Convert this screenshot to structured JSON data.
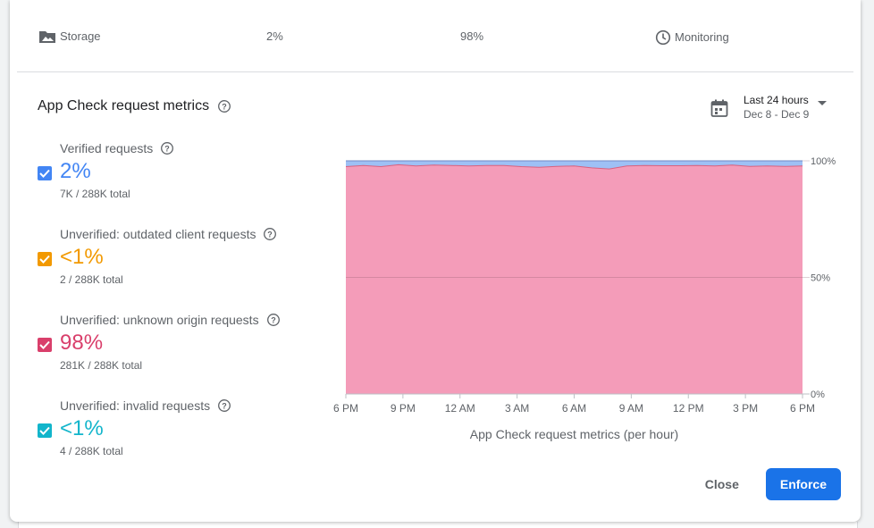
{
  "storage_row": {
    "label": "Storage",
    "verified_pct": "2%",
    "unverified_pct": "98%",
    "mode": "Monitoring"
  },
  "section": {
    "title": "App Check request metrics"
  },
  "date_picker": {
    "range": "Last 24 hours",
    "dates": "Dec 8 - Dec 9"
  },
  "metrics": [
    {
      "label": "Verified requests",
      "value": "2%",
      "sub": "7K / 288K total",
      "color": "#4285f4"
    },
    {
      "label": "Unverified: outdated client requests",
      "value": "<1%",
      "sub": "2 / 288K total",
      "color": "#f29900"
    },
    {
      "label": "Unverified: unknown origin requests",
      "value": "98%",
      "sub": "281K / 288K total",
      "color": "#d93f6b"
    },
    {
      "label": "Unverified: invalid requests",
      "value": "<1%",
      "sub": "4 / 288K total",
      "color": "#12b5cb"
    }
  ],
  "chart_data": {
    "type": "area",
    "stacked": true,
    "percent": true,
    "title": "",
    "xlabel": "App Check request metrics (per hour)",
    "ylabel": "",
    "x_ticks": [
      "6 PM",
      "9 PM",
      "12 AM",
      "3 AM",
      "6 AM",
      "9 AM",
      "12 PM",
      "3 PM",
      "6 PM"
    ],
    "y_ticks": [
      "100%",
      "50%",
      "0%"
    ],
    "ylim": [
      0,
      100
    ],
    "grid": "horizontal",
    "series": [
      {
        "values": [
          97.5,
          98,
          97.5,
          98.3,
          97.8,
          98.2,
          98,
          97.8,
          98,
          98,
          97.5,
          97.2,
          97.6,
          97.8,
          97,
          96.5,
          97.8,
          98,
          97.9,
          97.9,
          98,
          97.8,
          98.2,
          97.6,
          97.8,
          97.6,
          97.8
        ]
      },
      {
        "values": [
          2.5,
          2,
          2.5,
          1.7,
          2.2,
          1.8,
          2,
          2.2,
          2,
          2,
          2.5,
          2.8,
          2.4,
          2.2,
          3,
          3.5,
          2.2,
          2,
          2.1,
          2.1,
          2,
          2.2,
          1.8,
          2.4,
          2.2,
          2.4,
          2.2
        ]
      }
    ],
    "colors": [
      "#f49cb9",
      "#9ec0f5"
    ]
  },
  "actions": {
    "close": "Close",
    "enforce": "Enforce"
  }
}
